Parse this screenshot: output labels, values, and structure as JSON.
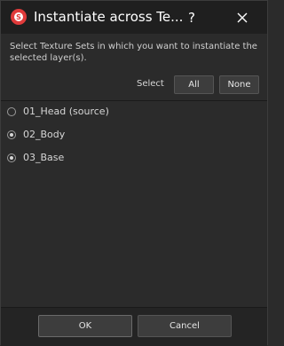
{
  "window": {
    "title": "Instantiate across Te...",
    "help_label": "?",
    "app_icon": "substance-painter-icon",
    "accent": "#e03b3b"
  },
  "description": "Select Texture Sets in which you want to instantiate the selected layer(s).",
  "select": {
    "label": "Select",
    "all_label": "All",
    "none_label": "None"
  },
  "texture_sets": [
    {
      "label": "01_Head (source)",
      "checked": false
    },
    {
      "label": "02_Body",
      "checked": true
    },
    {
      "label": "03_Base",
      "checked": true
    }
  ],
  "footer": {
    "ok_label": "OK",
    "cancel_label": "Cancel"
  }
}
